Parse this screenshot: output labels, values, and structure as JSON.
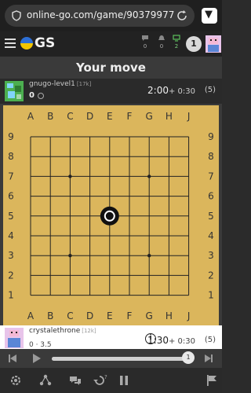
{
  "browser": {
    "url": "online-go.com/game/90379977",
    "shield_icon": "shield-icon",
    "reload_icon": "reload-icon",
    "brave_icon": "brave-lion-icon"
  },
  "nav": {
    "logo_text": "GS",
    "stats": [
      {
        "icon": "chat-icon",
        "value": "0"
      },
      {
        "icon": "bell-icon",
        "value": "0"
      },
      {
        "icon": "monitor-icon",
        "value": "2"
      }
    ],
    "rank_badge": "1"
  },
  "status": {
    "text": "Your move"
  },
  "top_player": {
    "name": "gnugo-level1",
    "rank": "[17k]",
    "score": "0",
    "time_main": "2:00",
    "time_byo": "+ 0:30",
    "periods": "(5)"
  },
  "bottom_player": {
    "name": "crystalethrone",
    "rank": "[12k]",
    "score": "0 · 3.5",
    "time_main": "1:30",
    "time_byo": "+ 0:30",
    "periods": "(5)"
  },
  "board": {
    "size": 9,
    "columns": [
      "A",
      "B",
      "C",
      "D",
      "E",
      "F",
      "G",
      "H",
      "J"
    ],
    "rows": [
      "9",
      "8",
      "7",
      "6",
      "5",
      "4",
      "3",
      "2",
      "1"
    ],
    "star_points": [
      "C7",
      "G7",
      "E5",
      "C3",
      "G3"
    ],
    "stones": [
      {
        "point": "E5",
        "color": "black",
        "last_move": true
      }
    ],
    "board_color": "#dbb65c"
  },
  "playback": {
    "controls": [
      "skip-back-icon",
      "play-icon",
      "skip-forward-icon"
    ],
    "move_number": "1",
    "progress": 1.0
  },
  "toolbar": {
    "icons": [
      "settings-icon",
      "share-icon",
      "chat-bubbles-icon",
      "undo-icon",
      "pause-icon",
      "flag-icon"
    ],
    "undo_badge": "?"
  },
  "colors": {
    "accent_blue": "#2d6fd6",
    "accent_yellow": "#f2c500",
    "board": "#dbb65c",
    "dark_bg": "#2b2b2b"
  }
}
